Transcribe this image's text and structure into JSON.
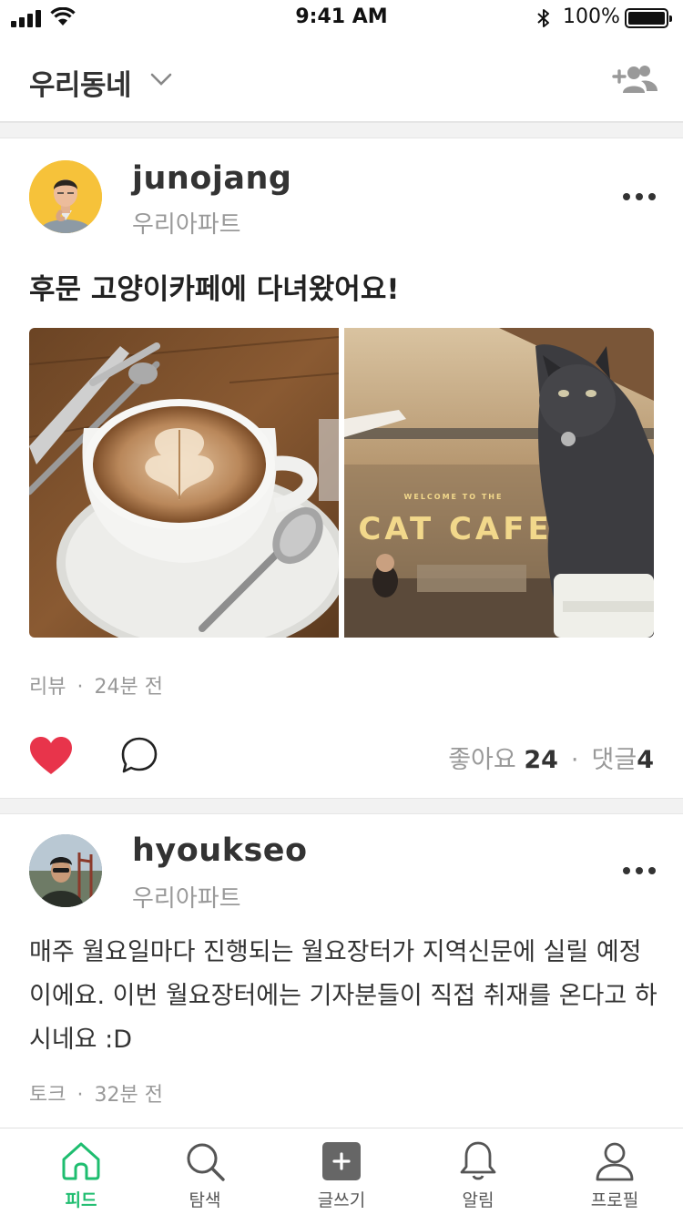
{
  "status_bar": {
    "time": "9:41 AM",
    "battery": "100%"
  },
  "nav": {
    "title": "우리동네"
  },
  "posts": [
    {
      "username": "junojang",
      "location": "우리아파트",
      "title": "후문 고양이카페에 다녀왔어요!",
      "photo_right_sign": "CAT CAFE",
      "photo_right_small_sign": "WELCOME TO THE",
      "category": "리뷰",
      "time_ago": "24분 전",
      "likes_label": "좋아요",
      "likes_count": "24",
      "comments_label": "댓글",
      "comments_count": "4",
      "liked": true
    },
    {
      "username": "hyoukseo",
      "location": "우리아파트",
      "text": "매주 월요일마다 진행되는 월요장터가 지역신문에 실릴 예정이에요. 이번 월요장터에는 기자분들이 직접 취재를 온다고 하시네요 :D",
      "category": "토크",
      "time_ago": "32분 전"
    }
  ],
  "tabs": [
    {
      "label": "피드",
      "icon": "home-icon",
      "active": true
    },
    {
      "label": "탐색",
      "icon": "search-icon"
    },
    {
      "label": "글쓰기",
      "icon": "write-plus-icon"
    },
    {
      "label": "알림",
      "icon": "bell-icon"
    },
    {
      "label": "프로필",
      "icon": "profile-icon"
    }
  ],
  "colors": {
    "accent": "#1ebd6f",
    "heart": "#e8344b"
  }
}
